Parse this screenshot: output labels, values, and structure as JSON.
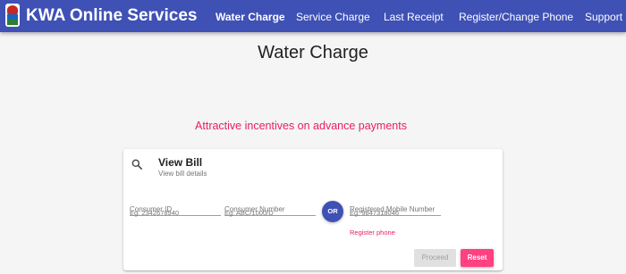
{
  "header": {
    "title": "KWA Online Services",
    "nav": [
      {
        "label": "Water Charge",
        "active": true
      },
      {
        "label": "Service Charge",
        "active": false
      },
      {
        "label": "Last Receipt",
        "active": false
      },
      {
        "label": "Register/Change Phone",
        "active": false
      },
      {
        "label": "Support",
        "active": false
      }
    ]
  },
  "page": {
    "title": "Water Charge",
    "promo": "Attractive incentives on advance payments"
  },
  "view_bill": {
    "icon": "search-icon",
    "title": "View Bill",
    "subtitle": "View bill details",
    "fields": [
      {
        "label": "Consumer ID",
        "value": "",
        "hint": "Eg: 2342678940"
      },
      {
        "label": "Consumer Number",
        "value": "",
        "hint": "Eg: ABC/1000/D"
      },
      {
        "label": "Registered Mobile Number",
        "value": "",
        "hint": "Eg: 9847318046"
      }
    ],
    "or_label": "OR",
    "register_link": "Register phone",
    "proceed_label": "Proceed",
    "reset_label": "Reset"
  },
  "colors": {
    "primary": "#3f51b5",
    "accent": "#e91e63",
    "reset_button": "#ff4081",
    "disabled_button": "#e0e0e0"
  }
}
